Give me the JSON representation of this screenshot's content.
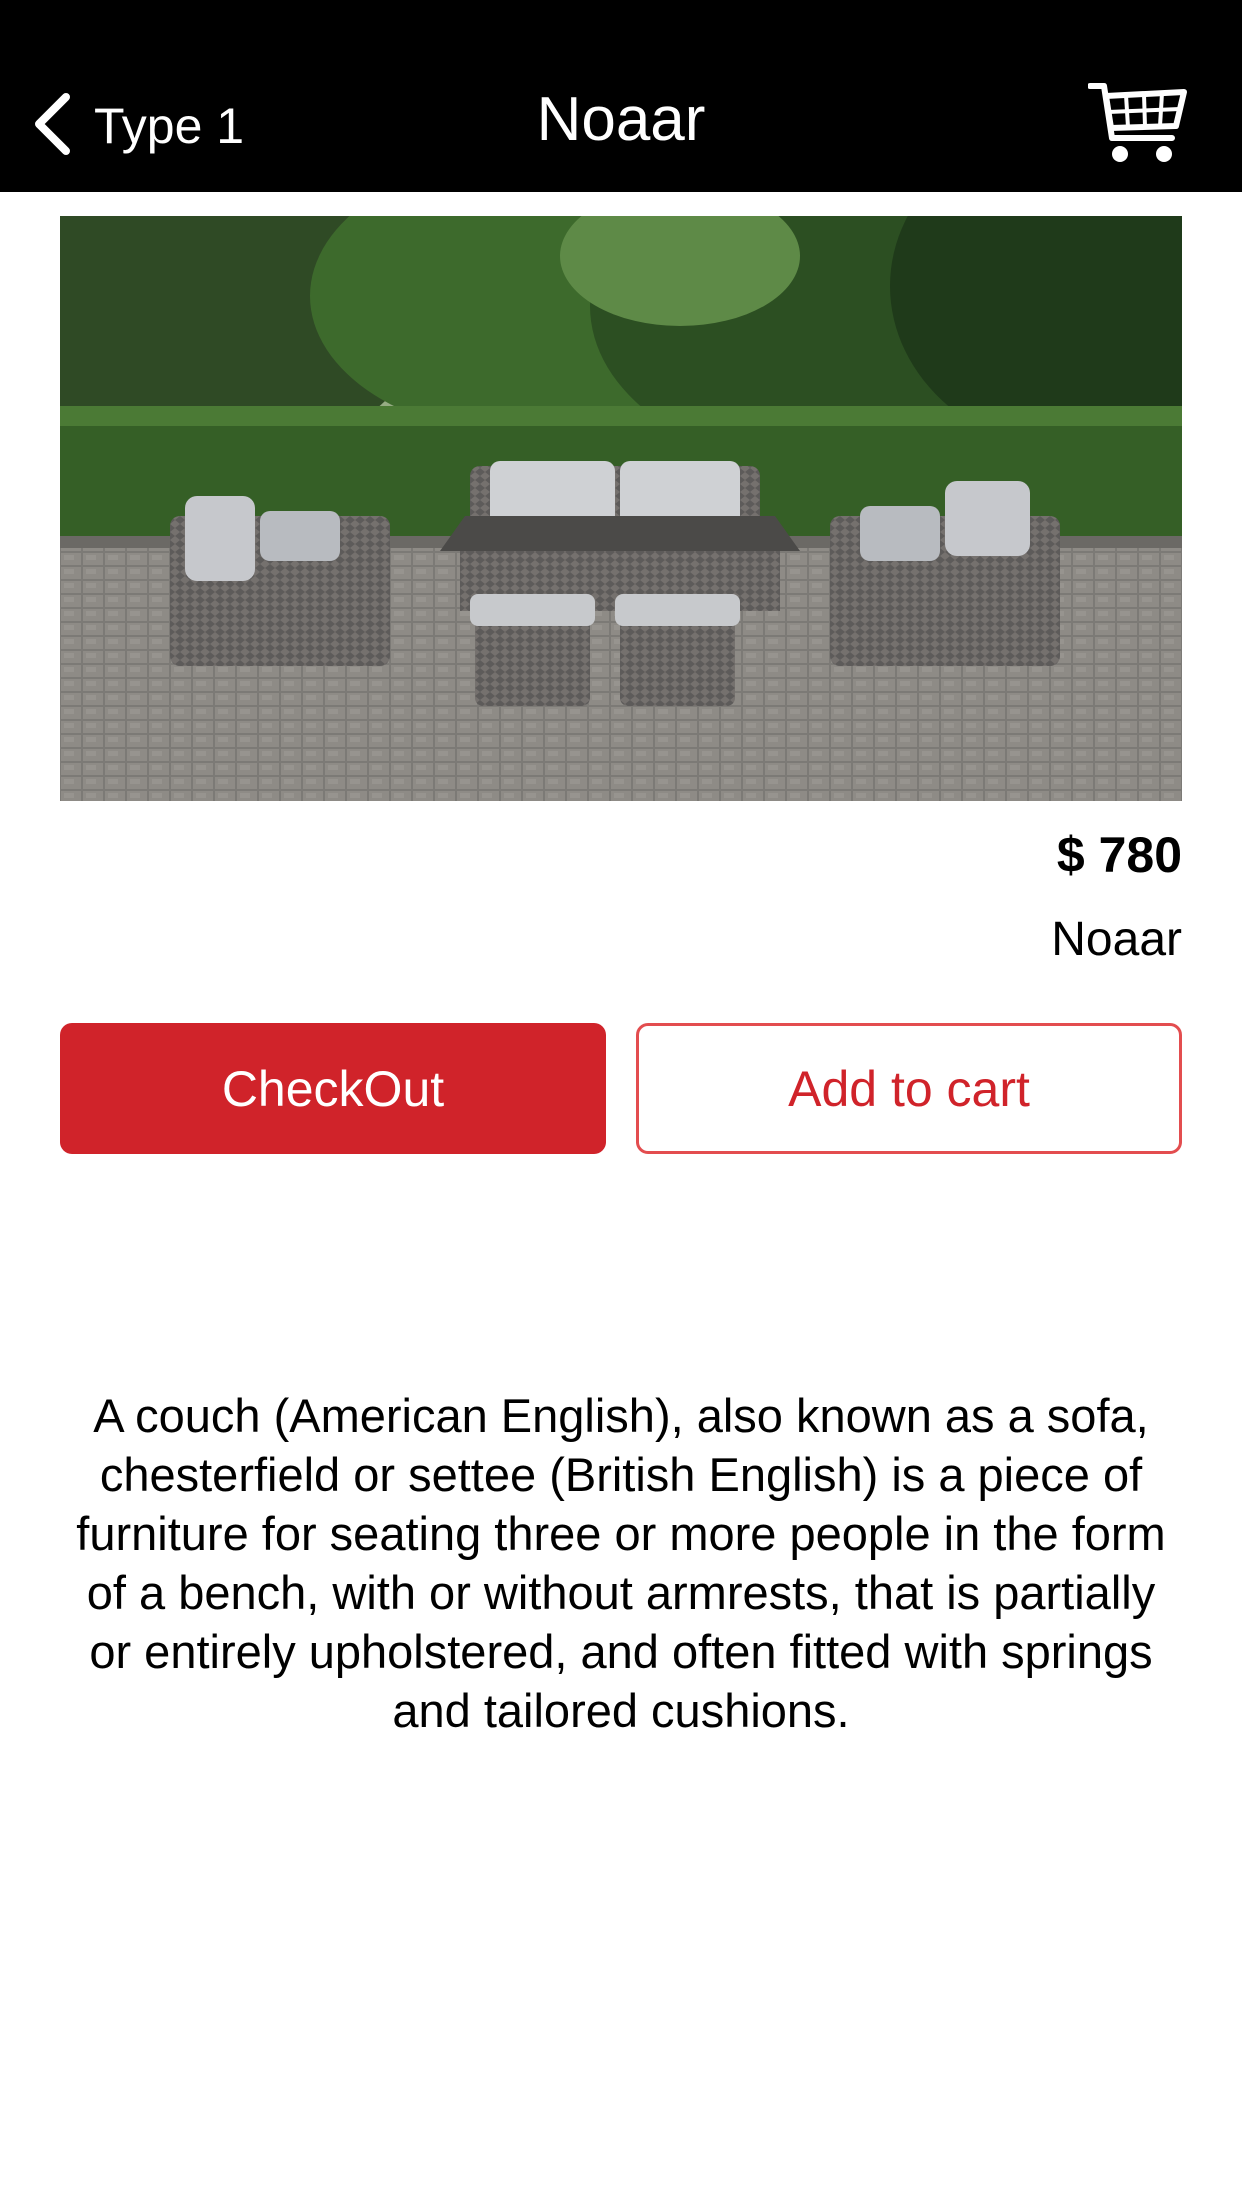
{
  "nav": {
    "back_label": "Type 1",
    "title": "Noaar",
    "back_icon": "chevron-left-icon",
    "cart_icon": "shopping-cart-icon"
  },
  "product": {
    "image_alt": "Outdoor rattan sofa set on a paved patio",
    "price": "$ 780",
    "brand": "Noaar",
    "description": "A couch (American English), also known as a sofa, chesterfield or settee (British English) is a piece of furniture for seating three or more people in the form of a bench, with or without armrests, that is partially or entirely upholstered, and often fitted with springs and tailored cushions."
  },
  "actions": {
    "checkout_label": "CheckOut",
    "add_to_cart_label": "Add to cart"
  },
  "colors": {
    "navbar": "#000000",
    "accent": "#d0232a",
    "accent_border": "#e34d4f"
  }
}
